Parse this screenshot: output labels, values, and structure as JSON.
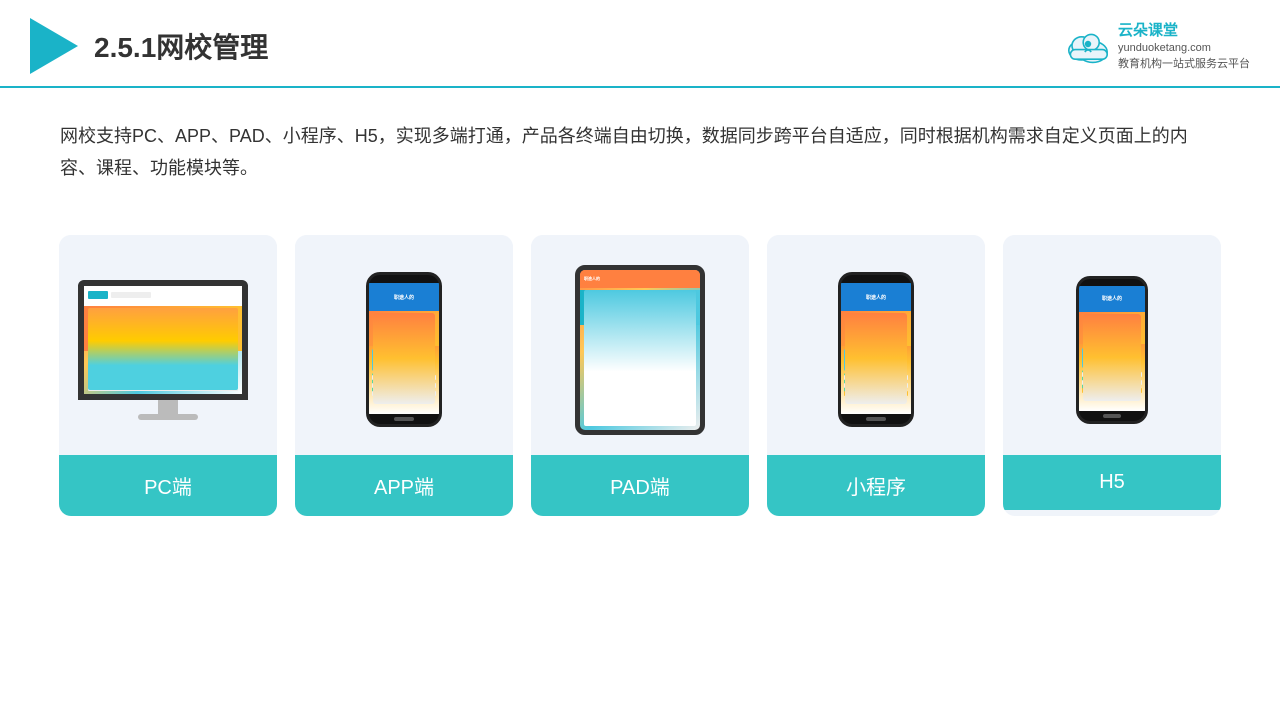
{
  "header": {
    "title": "2.5.1网校管理",
    "logo_name": "云朵课堂",
    "logo_url": "yunduoketang.com",
    "logo_tagline": "教育机构一站式服务云平台"
  },
  "description": {
    "text": "网校支持PC、APP、PAD、小程序、H5，实现多端打通，产品各终端自由切换，数据同步跨平台自适应，同时根据机构需求自定义页面上的内容、课程、功能模块等。"
  },
  "cards": [
    {
      "id": "pc",
      "label": "PC端"
    },
    {
      "id": "app",
      "label": "APP端"
    },
    {
      "id": "pad",
      "label": "PAD端"
    },
    {
      "id": "mini",
      "label": "小程序"
    },
    {
      "id": "h5",
      "label": "H5"
    }
  ],
  "colors": {
    "accent": "#1ab3c8",
    "teal": "#35c5c5",
    "divider": "#1ab3c8"
  }
}
